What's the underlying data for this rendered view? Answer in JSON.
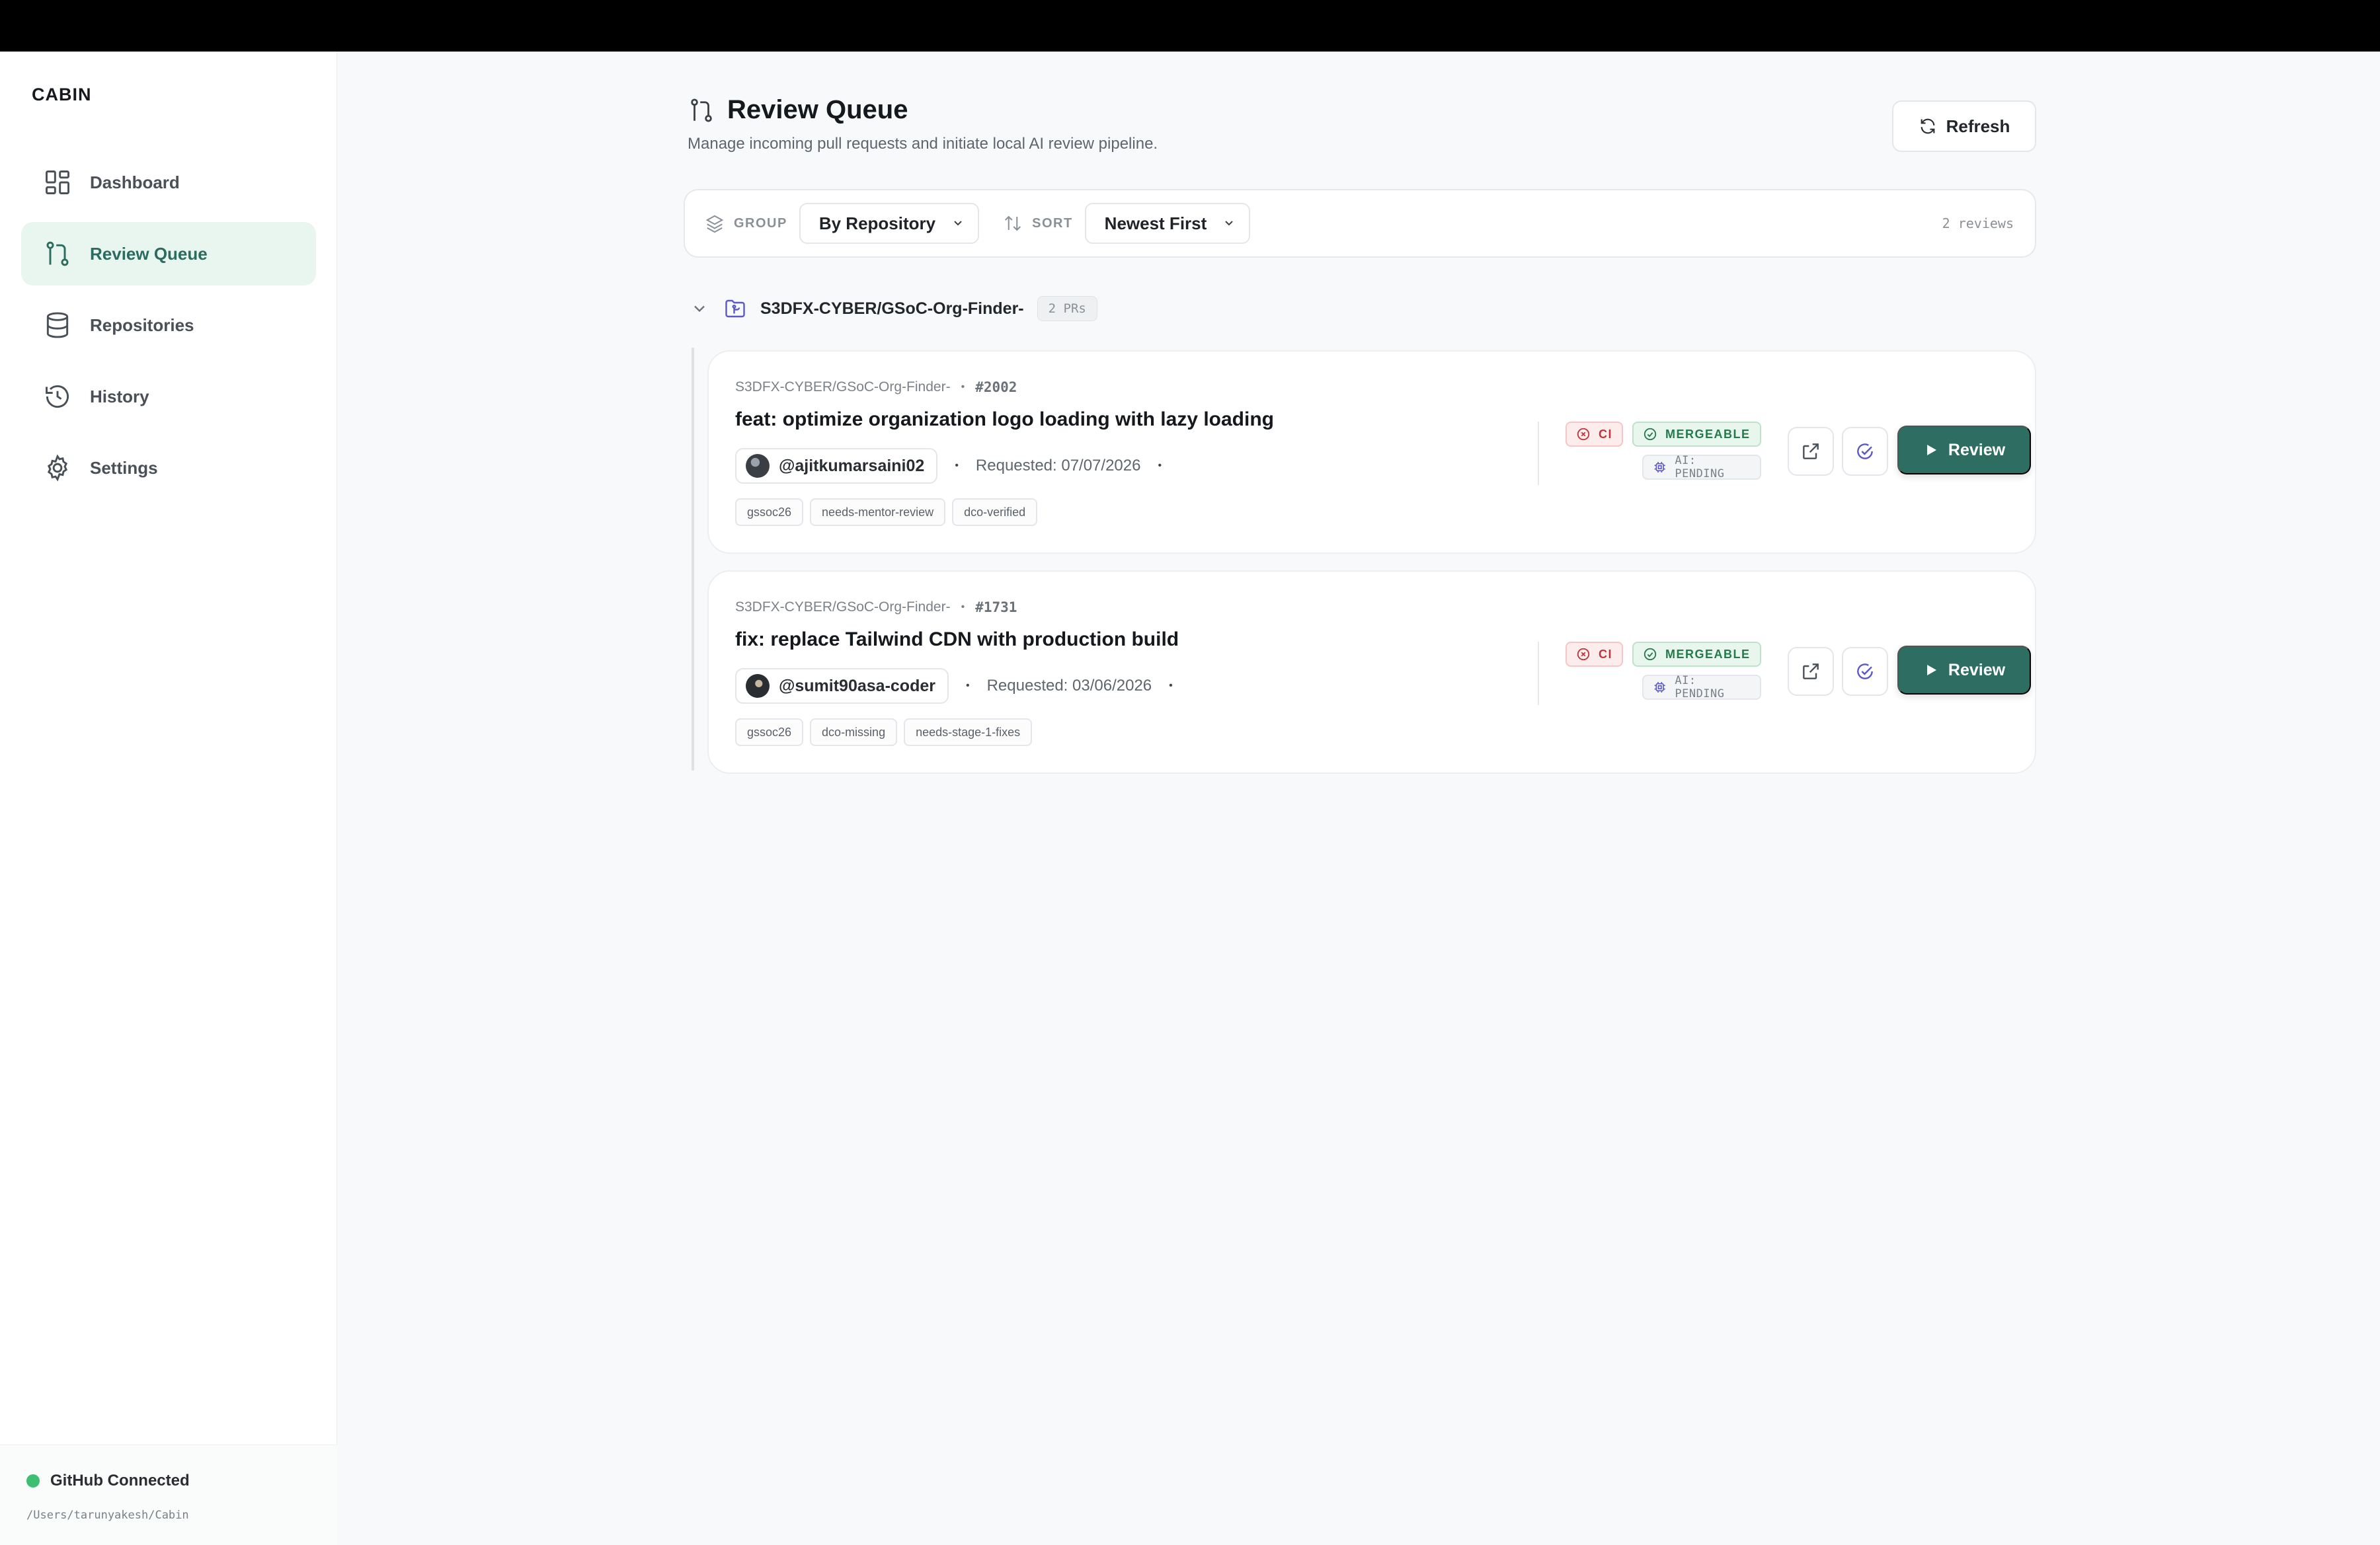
{
  "app": {
    "brand": "CABIN"
  },
  "sidebar": {
    "items": [
      {
        "label": "Dashboard",
        "icon": "dashboard-icon",
        "active": false
      },
      {
        "label": "Review Queue",
        "icon": "git-pull-request-icon",
        "active": true
      },
      {
        "label": "Repositories",
        "icon": "database-icon",
        "active": false
      },
      {
        "label": "History",
        "icon": "history-icon",
        "active": false
      },
      {
        "label": "Settings",
        "icon": "gear-icon",
        "active": false
      }
    ],
    "footer": {
      "status": "GitHub Connected",
      "path": "/Users/tarunyakesh/Cabin"
    }
  },
  "header": {
    "title": "Review Queue",
    "subtitle": "Manage incoming pull requests and initiate local AI review pipeline.",
    "refresh_label": "Refresh"
  },
  "toolbar": {
    "group_label": "GROUP",
    "group_value": "By Repository",
    "sort_label": "SORT",
    "sort_value": "Newest First",
    "count": "2 reviews"
  },
  "group": {
    "name": "S3DFX-CYBER/GSoC-Org-Finder-",
    "count": "2 PRs"
  },
  "prs": [
    {
      "repo": "S3DFX-CYBER/GSoC-Org-Finder-",
      "number": "#2002",
      "title": "feat: optimize organization logo loading with lazy loading",
      "author": "@ajitkumarsaini02",
      "requested": "Requested: 07/07/2026",
      "tags": [
        "gssoc26",
        "needs-mentor-review",
        "dco-verified"
      ],
      "ci": "CI",
      "mergeable": "MERGEABLE",
      "ai": "AI: PENDING",
      "review_label": "Review"
    },
    {
      "repo": "S3DFX-CYBER/GSoC-Org-Finder-",
      "number": "#1731",
      "title": "fix: replace Tailwind CDN with production build",
      "author": "@sumit90asa-coder",
      "requested": "Requested: 03/06/2026",
      "tags": [
        "gssoc26",
        "dco-missing",
        "needs-stage-1-fixes"
      ],
      "ci": "CI",
      "mergeable": "MERGEABLE",
      "ai": "AI: PENDING",
      "review_label": "Review"
    }
  ],
  "colors": {
    "accent": "#2e6d62",
    "active_bg": "#e9f6ef",
    "ci_fail": "#c0353a",
    "merge_ok": "#257a4b",
    "connected": "#3cbf72"
  }
}
